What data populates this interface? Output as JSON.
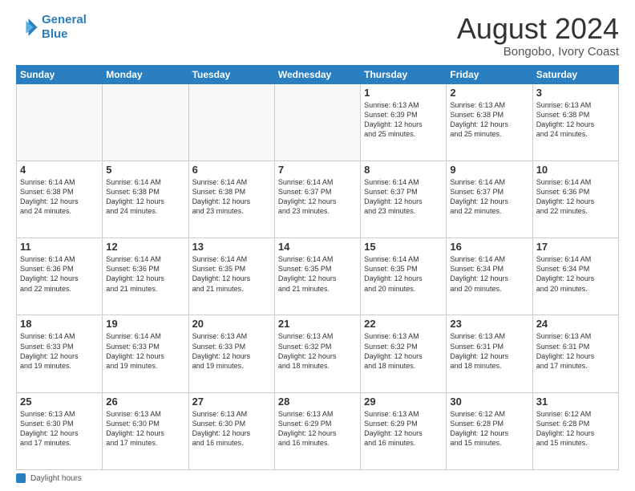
{
  "logo": {
    "line1": "General",
    "line2": "Blue"
  },
  "title": "August 2024",
  "location": "Bongobo, Ivory Coast",
  "days_of_week": [
    "Sunday",
    "Monday",
    "Tuesday",
    "Wednesday",
    "Thursday",
    "Friday",
    "Saturday"
  ],
  "footer_label": "Daylight hours",
  "weeks": [
    [
      {
        "num": "",
        "info": ""
      },
      {
        "num": "",
        "info": ""
      },
      {
        "num": "",
        "info": ""
      },
      {
        "num": "",
        "info": ""
      },
      {
        "num": "1",
        "info": "Sunrise: 6:13 AM\nSunset: 6:39 PM\nDaylight: 12 hours\nand 25 minutes."
      },
      {
        "num": "2",
        "info": "Sunrise: 6:13 AM\nSunset: 6:38 PM\nDaylight: 12 hours\nand 25 minutes."
      },
      {
        "num": "3",
        "info": "Sunrise: 6:13 AM\nSunset: 6:38 PM\nDaylight: 12 hours\nand 24 minutes."
      }
    ],
    [
      {
        "num": "4",
        "info": "Sunrise: 6:14 AM\nSunset: 6:38 PM\nDaylight: 12 hours\nand 24 minutes."
      },
      {
        "num": "5",
        "info": "Sunrise: 6:14 AM\nSunset: 6:38 PM\nDaylight: 12 hours\nand 24 minutes."
      },
      {
        "num": "6",
        "info": "Sunrise: 6:14 AM\nSunset: 6:38 PM\nDaylight: 12 hours\nand 23 minutes."
      },
      {
        "num": "7",
        "info": "Sunrise: 6:14 AM\nSunset: 6:37 PM\nDaylight: 12 hours\nand 23 minutes."
      },
      {
        "num": "8",
        "info": "Sunrise: 6:14 AM\nSunset: 6:37 PM\nDaylight: 12 hours\nand 23 minutes."
      },
      {
        "num": "9",
        "info": "Sunrise: 6:14 AM\nSunset: 6:37 PM\nDaylight: 12 hours\nand 22 minutes."
      },
      {
        "num": "10",
        "info": "Sunrise: 6:14 AM\nSunset: 6:36 PM\nDaylight: 12 hours\nand 22 minutes."
      }
    ],
    [
      {
        "num": "11",
        "info": "Sunrise: 6:14 AM\nSunset: 6:36 PM\nDaylight: 12 hours\nand 22 minutes."
      },
      {
        "num": "12",
        "info": "Sunrise: 6:14 AM\nSunset: 6:36 PM\nDaylight: 12 hours\nand 21 minutes."
      },
      {
        "num": "13",
        "info": "Sunrise: 6:14 AM\nSunset: 6:35 PM\nDaylight: 12 hours\nand 21 minutes."
      },
      {
        "num": "14",
        "info": "Sunrise: 6:14 AM\nSunset: 6:35 PM\nDaylight: 12 hours\nand 21 minutes."
      },
      {
        "num": "15",
        "info": "Sunrise: 6:14 AM\nSunset: 6:35 PM\nDaylight: 12 hours\nand 20 minutes."
      },
      {
        "num": "16",
        "info": "Sunrise: 6:14 AM\nSunset: 6:34 PM\nDaylight: 12 hours\nand 20 minutes."
      },
      {
        "num": "17",
        "info": "Sunrise: 6:14 AM\nSunset: 6:34 PM\nDaylight: 12 hours\nand 20 minutes."
      }
    ],
    [
      {
        "num": "18",
        "info": "Sunrise: 6:14 AM\nSunset: 6:33 PM\nDaylight: 12 hours\nand 19 minutes."
      },
      {
        "num": "19",
        "info": "Sunrise: 6:14 AM\nSunset: 6:33 PM\nDaylight: 12 hours\nand 19 minutes."
      },
      {
        "num": "20",
        "info": "Sunrise: 6:13 AM\nSunset: 6:33 PM\nDaylight: 12 hours\nand 19 minutes."
      },
      {
        "num": "21",
        "info": "Sunrise: 6:13 AM\nSunset: 6:32 PM\nDaylight: 12 hours\nand 18 minutes."
      },
      {
        "num": "22",
        "info": "Sunrise: 6:13 AM\nSunset: 6:32 PM\nDaylight: 12 hours\nand 18 minutes."
      },
      {
        "num": "23",
        "info": "Sunrise: 6:13 AM\nSunset: 6:31 PM\nDaylight: 12 hours\nand 18 minutes."
      },
      {
        "num": "24",
        "info": "Sunrise: 6:13 AM\nSunset: 6:31 PM\nDaylight: 12 hours\nand 17 minutes."
      }
    ],
    [
      {
        "num": "25",
        "info": "Sunrise: 6:13 AM\nSunset: 6:30 PM\nDaylight: 12 hours\nand 17 minutes."
      },
      {
        "num": "26",
        "info": "Sunrise: 6:13 AM\nSunset: 6:30 PM\nDaylight: 12 hours\nand 17 minutes."
      },
      {
        "num": "27",
        "info": "Sunrise: 6:13 AM\nSunset: 6:30 PM\nDaylight: 12 hours\nand 16 minutes."
      },
      {
        "num": "28",
        "info": "Sunrise: 6:13 AM\nSunset: 6:29 PM\nDaylight: 12 hours\nand 16 minutes."
      },
      {
        "num": "29",
        "info": "Sunrise: 6:13 AM\nSunset: 6:29 PM\nDaylight: 12 hours\nand 16 minutes."
      },
      {
        "num": "30",
        "info": "Sunrise: 6:12 AM\nSunset: 6:28 PM\nDaylight: 12 hours\nand 15 minutes."
      },
      {
        "num": "31",
        "info": "Sunrise: 6:12 AM\nSunset: 6:28 PM\nDaylight: 12 hours\nand 15 minutes."
      }
    ]
  ]
}
